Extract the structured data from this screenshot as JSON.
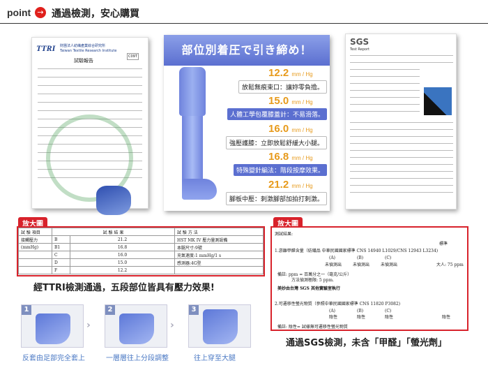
{
  "header": {
    "point_label": "point",
    "arrow_glyph": "→",
    "title": "通過檢測，安心購買"
  },
  "ttri_doc": {
    "logo": "TTRI",
    "org_zh": "財團法人紡織產業綜合研究所",
    "org_en": "Taiwan Textile Research Institute",
    "report_title": "試驗報告",
    "report_no": "C09T"
  },
  "sgs_doc": {
    "logo": "SGS",
    "subtitle": "Test Report"
  },
  "poster": {
    "title": "部位別着圧で引き締め！",
    "levels": [
      {
        "value": "12.2",
        "unit": "mm / Hg",
        "desc": "放鬆無痕束口：讓妳零負擔。",
        "style": "d1"
      },
      {
        "value": "15.0",
        "unit": "mm / Hg",
        "desc": "人體工學包覆膝蓋計：不易滑落。",
        "style": "d2"
      },
      {
        "value": "16.0",
        "unit": "mm / Hg",
        "desc": "強壓護膝：立即放鬆舒緩大小腿。",
        "style": "d1"
      },
      {
        "value": "16.8",
        "unit": "mm / Hg",
        "desc": "特殊變針編法：階段按摩效果。",
        "style": "d2"
      },
      {
        "value": "21.2",
        "unit": "mm / Hg",
        "desc": "腳板中壓：刺激腳部加拍打刺激。",
        "style": "d1"
      }
    ]
  },
  "ttri_table": {
    "tag": "放大圖",
    "headers": [
      "試 驗 項目",
      "試 驗 結 果",
      "試 驗 方 法"
    ],
    "item": "接觸壓力",
    "item_unit": "(mmHg)",
    "rows": [
      {
        "pos": "B",
        "val": "21.2",
        "method": "HST MK IV 壓力量測設備"
      },
      {
        "pos": "B1",
        "val": "16.8",
        "method": "本腿尺寸:9號"
      },
      {
        "pos": "C",
        "val": "16.0",
        "method": "充氣速度:1 mmHg/1 s"
      },
      {
        "pos": "D",
        "val": "15.0",
        "method": "感測器:4G型"
      },
      {
        "pos": "F",
        "val": "12.2",
        "method": ""
      }
    ],
    "caption": "經TTRI檢測通過，五段部位皆具有壓力效果!"
  },
  "sgs_table": {
    "tag": "放大圖",
    "heading": "測試結果:",
    "sample_label": "標準",
    "line1": "1.游離甲醛含量（紡織品 中華民國國家標準 CNS 14940 L1029/CNS 12943 L3234)",
    "cols": [
      "(A)",
      "(B)",
      "(C)"
    ],
    "row1_vals": [
      "未偵測出",
      "未偵測出",
      "未偵測出"
    ],
    "row1_std": "大人: 75 ppm",
    "note1": "備註: ppm = 百萬分之一（毫克/公斤）",
    "note1b": "方法偵測極限: 5 ppm.",
    "stamp": "美妙由台灣 SGS 其他實驗室執行",
    "line2": "2.可遷移性螢光物質（參照中華民國國家標準 CNS 11820 P3082)",
    "row2_vals": [
      "陰性",
      "陰性",
      "陰性"
    ],
    "row2_std": "陰性",
    "note2": "備註: 陰性= 試樣無可遷移性螢光物質",
    "caption": "通過SGS檢測，未含「甲醛」「螢光劑」"
  },
  "steps": [
    {
      "num": "1",
      "label": "反套由足部完全套上"
    },
    {
      "num": "2",
      "label": "一層層往上分段調整"
    },
    {
      "num": "3",
      "label": "往上穿至大腿"
    }
  ],
  "colors": {
    "accent_red": "#d8222b",
    "poster_blue": "#5b6fd0",
    "level_orange": "#e79a1b",
    "step_text": "#4b79c4"
  }
}
